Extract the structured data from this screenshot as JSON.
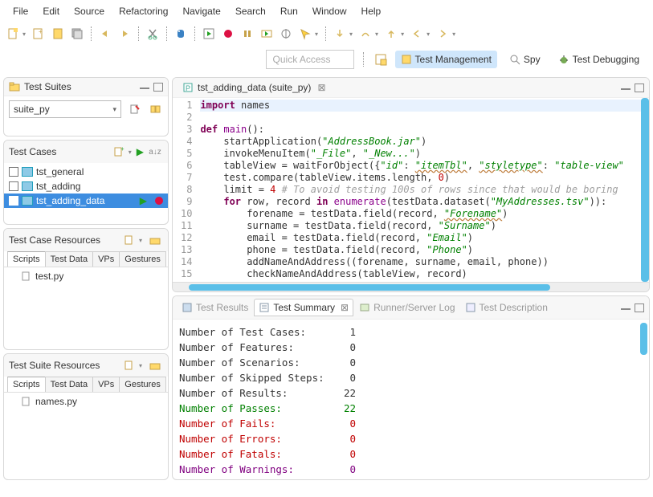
{
  "menu": [
    "File",
    "Edit",
    "Source",
    "Refactoring",
    "Navigate",
    "Search",
    "Run",
    "Window",
    "Help"
  ],
  "quick_access_placeholder": "Quick Access",
  "perspectives": {
    "active": "Test Management",
    "spy": "Spy",
    "debug": "Test Debugging"
  },
  "test_suites": {
    "title": "Test Suites",
    "selected": "suite_py"
  },
  "test_cases": {
    "title": "Test Cases",
    "items": [
      "tst_general",
      "tst_adding",
      "tst_adding_data"
    ],
    "selected_index": 2
  },
  "tc_resources": {
    "title": "Test Case Resources",
    "tabs": [
      "Scripts",
      "Test Data",
      "VPs",
      "Gestures"
    ],
    "active": 0,
    "file": "test.py"
  },
  "ts_resources": {
    "title": "Test Suite Resources",
    "tabs": [
      "Scripts",
      "Test Data",
      "VPs",
      "Gestures"
    ],
    "active": 0,
    "file": "names.py"
  },
  "editor": {
    "tab": "tst_adding_data (suite_py)",
    "lines": [
      {
        "n": 1,
        "tokens": [
          {
            "t": "import",
            "c": "kw2"
          },
          {
            "t": " names"
          }
        ]
      },
      {
        "n": 2,
        "tokens": []
      },
      {
        "n": 3,
        "tokens": [
          {
            "t": "def",
            "c": "kw2"
          },
          {
            "t": " "
          },
          {
            "t": "main",
            "c": "bi"
          },
          {
            "t": "():"
          }
        ]
      },
      {
        "n": 4,
        "tokens": [
          {
            "t": "    startApplication("
          },
          {
            "t": "\"AddressBook.jar\"",
            "c": "str"
          },
          {
            "t": ")"
          }
        ]
      },
      {
        "n": 5,
        "tokens": [
          {
            "t": "    invokeMenuItem("
          },
          {
            "t": "\"_File\"",
            "c": "str"
          },
          {
            "t": ", "
          },
          {
            "t": "\"_New...\"",
            "c": "str"
          },
          {
            "t": ")"
          }
        ]
      },
      {
        "n": 6,
        "tokens": [
          {
            "t": "    tableView = waitForObject({"
          },
          {
            "t": "\"id\"",
            "c": "str"
          },
          {
            "t": ": "
          },
          {
            "t": "\"itemTbl\"",
            "c": "str-u"
          },
          {
            "t": ", "
          },
          {
            "t": "\"styletype\"",
            "c": "str-u"
          },
          {
            "t": ": "
          },
          {
            "t": "\"table-view\"",
            "c": "str"
          }
        ]
      },
      {
        "n": 7,
        "tokens": [
          {
            "t": "    test.compare(tableView.items.length, "
          },
          {
            "t": "0",
            "c": "num"
          },
          {
            "t": ")"
          }
        ]
      },
      {
        "n": 8,
        "tokens": [
          {
            "t": "    limit = "
          },
          {
            "t": "4",
            "c": "num"
          },
          {
            "t": " "
          },
          {
            "t": "# To avoid testing 100s of rows since that would be boring",
            "c": "com"
          }
        ]
      },
      {
        "n": 9,
        "tokens": [
          {
            "t": "    "
          },
          {
            "t": "for",
            "c": "kw2"
          },
          {
            "t": " row, record "
          },
          {
            "t": "in",
            "c": "kw2"
          },
          {
            "t": " "
          },
          {
            "t": "enumerate",
            "c": "bi"
          },
          {
            "t": "(testData.dataset("
          },
          {
            "t": "\"MyAddresses.tsv\"",
            "c": "str"
          },
          {
            "t": ")):"
          }
        ]
      },
      {
        "n": 10,
        "tokens": [
          {
            "t": "        forename = testData.field(record, "
          },
          {
            "t": "\"Forename\"",
            "c": "str-u"
          },
          {
            "t": ")"
          }
        ]
      },
      {
        "n": 11,
        "tokens": [
          {
            "t": "        surname = testData.field(record, "
          },
          {
            "t": "\"Surname\"",
            "c": "str"
          },
          {
            "t": ")"
          }
        ]
      },
      {
        "n": 12,
        "tokens": [
          {
            "t": "        email = testData.field(record, "
          },
          {
            "t": "\"Email\"",
            "c": "str"
          },
          {
            "t": ")"
          }
        ]
      },
      {
        "n": 13,
        "tokens": [
          {
            "t": "        phone = testData.field(record, "
          },
          {
            "t": "\"Phone\"",
            "c": "str"
          },
          {
            "t": ")"
          }
        ]
      },
      {
        "n": 14,
        "tokens": [
          {
            "t": "        addNameAndAddress((forename, surname, email, phone))"
          }
        ]
      },
      {
        "n": 15,
        "tokens": [
          {
            "t": "        checkNameAndAddress(tableView, record)"
          }
        ]
      }
    ]
  },
  "bottom_tabs": [
    "Test Results",
    "Test Summary",
    "Runner/Server Log",
    "Test Description"
  ],
  "summary": [
    {
      "label": "Number of Test Cases:",
      "value": "1",
      "c": ""
    },
    {
      "label": "Number of Features:",
      "value": "0",
      "c": ""
    },
    {
      "label": "Number of Scenarios:",
      "value": "0",
      "c": ""
    },
    {
      "label": "Number of Skipped Steps:",
      "value": "0",
      "c": ""
    },
    {
      "label": "Number of Results:",
      "value": "22",
      "c": ""
    },
    {
      "label": "Number of Passes:",
      "value": "22",
      "c": "green"
    },
    {
      "label": "Number of Fails:",
      "value": "0",
      "c": "red"
    },
    {
      "label": "Number of Errors:",
      "value": "0",
      "c": "red"
    },
    {
      "label": "Number of Fatals:",
      "value": "0",
      "c": "red"
    },
    {
      "label": "Number of Warnings:",
      "value": "0",
      "c": "purple"
    }
  ]
}
